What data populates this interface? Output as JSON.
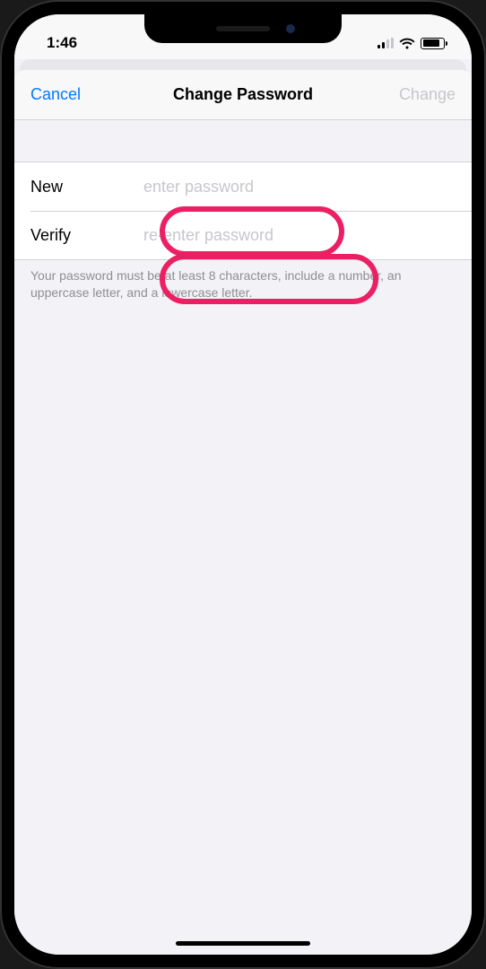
{
  "status_bar": {
    "time": "1:46"
  },
  "nav": {
    "cancel_label": "Cancel",
    "title": "Change Password",
    "change_label": "Change"
  },
  "form": {
    "new_label": "New",
    "new_placeholder": "enter password",
    "verify_label": "Verify",
    "verify_placeholder": "re-enter password"
  },
  "footer_text": "Your password must be at least 8 characters, include a number, an uppercase letter, and a lowercase letter."
}
